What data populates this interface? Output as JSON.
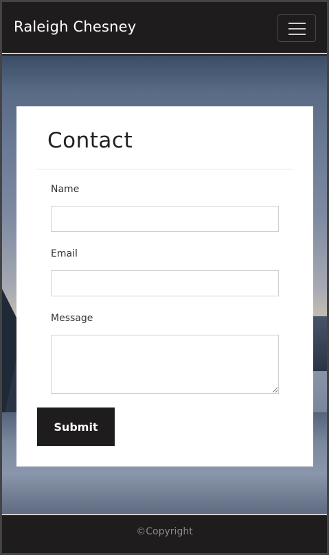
{
  "navbar": {
    "brand": "Raleigh Chesney",
    "menu_icon": "hamburger-menu-icon"
  },
  "contact": {
    "title": "Contact",
    "name_label": "Name",
    "name_value": "",
    "email_label": "Email",
    "email_value": "",
    "message_label": "Message",
    "message_value": "",
    "submit_label": "Submit"
  },
  "footer": {
    "copyright": "©Copyright"
  },
  "colors": {
    "navbar_bg": "#1e1c1d",
    "card_bg": "#ffffff",
    "button_bg": "#1e1c1d",
    "button_text": "#ffffff"
  }
}
